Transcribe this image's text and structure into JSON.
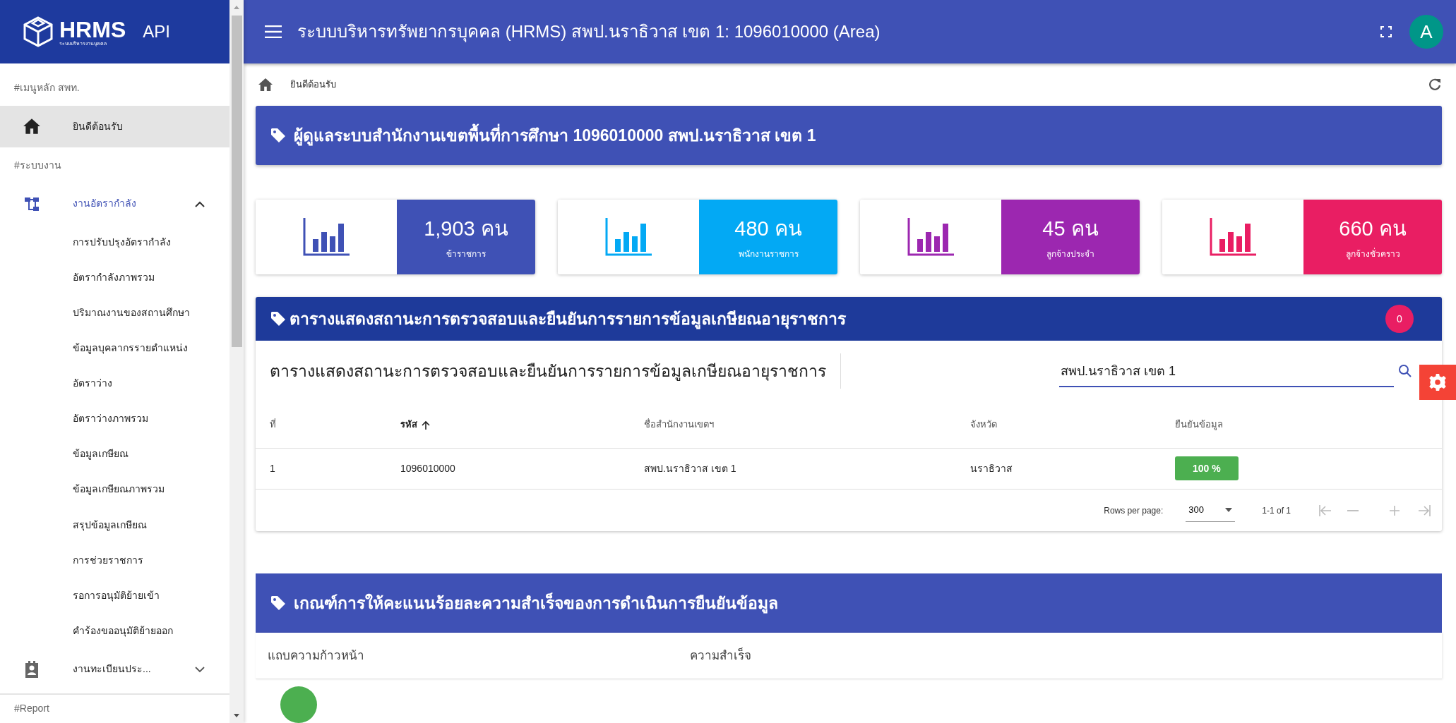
{
  "sidebar": {
    "logo_text": "HRMS",
    "logo_subtext": "ระบบบริหารงานบุคคล",
    "api_label": "API",
    "sections": [
      {
        "label": "#เมนูหลัก สพท.",
        "items": [
          {
            "label": "ยินดีต้อนรับ",
            "selected": true
          }
        ]
      },
      {
        "label": "#ระบบงาน",
        "items": [
          {
            "label": "งานอัตรากำลัง",
            "selected": false,
            "expanded": true,
            "children": [
              {
                "label": "การปรับปรุงอัตรากำลัง"
              },
              {
                "label": "อัตรากำลังภาพรวม"
              },
              {
                "label": "ปริมาณงานของสถานศึกษา"
              },
              {
                "label": "ข้อมูลบุคลากรรายตำแหน่ง"
              },
              {
                "label": "อัตราว่าง"
              },
              {
                "label": "อัตราว่างภาพรวม"
              },
              {
                "label": "ข้อมูลเกษียณ"
              },
              {
                "label": "ข้อมูลเกษียณภาพรวม"
              },
              {
                "label": "สรุปข้อมูลเกษียณ"
              },
              {
                "label": "การช่วยราชการ"
              },
              {
                "label": "รอการอนุมัติย้ายเข้า"
              },
              {
                "label": "คำร้องขออนุมัติย้ายออก"
              }
            ]
          },
          {
            "label": "งานทะเบียนประ...",
            "selected": false,
            "expanded": false
          }
        ]
      },
      {
        "label": "#Report"
      }
    ]
  },
  "header": {
    "title": "ระบบบริหารทรัพยากรบุคคล (HRMS) สพป.นราธิวาส เขต 1: 1096010000 (Area)",
    "avatar": "A"
  },
  "breadcrumb": {
    "label": "ยินดีต้อนรับ"
  },
  "banner": {
    "title": "ผู้ดูแลระบบสำนักงานเขตพื้นที่การศึกษา 1096010000 สพป.นราธิวาส เขต 1"
  },
  "stats": [
    {
      "value": "1,903 คน",
      "label": "ข้าราชการ",
      "color": "#3f51b5"
    },
    {
      "value": "480 คน",
      "label": "พนักงานราชการ",
      "color": "#03a9f4"
    },
    {
      "value": "45 คน",
      "label": "ลูกจ้างประจำ",
      "color": "#9c27b0"
    },
    {
      "value": "660 คน",
      "label": "ลูกจ้างชั่วคราว",
      "color": "#e91e63"
    }
  ],
  "retirement_table": {
    "title": "ตารางแสดงสถานะการตรวจสอบและยืนยันการรายการข้อมูลเกษียณอายุราชการ",
    "badge": "0",
    "subtitle": "ตารางแสดงสถานะการตรวจสอบและยืนยันการรายการข้อมูลเกษียณอายุราชการ",
    "search": {
      "value": "สพป.นราธิวาส เขต 1"
    },
    "columns": [
      {
        "label": "ที่",
        "sorted": false
      },
      {
        "label": "รหัส",
        "sorted": true
      },
      {
        "label": "ชื่อสำนักงานเขตฯ",
        "sorted": false
      },
      {
        "label": "จังหวัด",
        "sorted": false
      },
      {
        "label": "ยืนยันข้อมูล",
        "sorted": false
      }
    ],
    "rows": [
      [
        {
          "text": "1",
          "kind": "text"
        },
        {
          "text": "1096010000",
          "kind": "text"
        },
        {
          "text": "สพป.นราธิวาส เขต 1",
          "kind": "text"
        },
        {
          "text": "นราธิวาส",
          "kind": "text"
        },
        {
          "text": "100 %",
          "kind": "badge"
        }
      ]
    ],
    "footer": {
      "rows_per_page_label": "Rows per page:",
      "rows_per_page": "300",
      "range": "1-1 of 1"
    }
  },
  "criteria": {
    "title": "เกณฑ์การให้คะแนนร้อยละความสำเร็จของการดำเนินการยืนยันข้อมูล",
    "columns": [
      "แถบความก้าวหน้า",
      "ความสำเร็จ"
    ]
  }
}
